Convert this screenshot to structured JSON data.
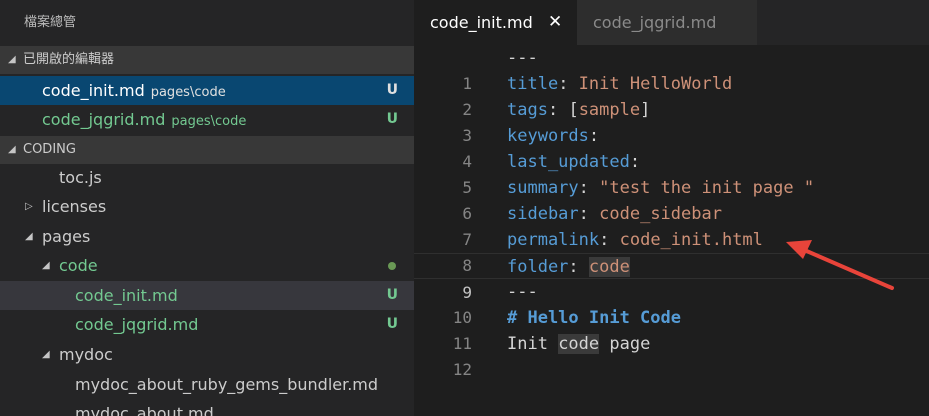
{
  "explorer": {
    "title": "檔案總管",
    "open_editors": {
      "label": "已開啟的編輯器",
      "items": [
        {
          "name": "code_init.md",
          "path": "pages\\code",
          "badge": "U"
        },
        {
          "name": "code_jqgrid.md",
          "path": "pages\\code",
          "badge": "U"
        }
      ]
    },
    "workspace": {
      "label": "CODING",
      "items": [
        {
          "name": "toc.js"
        },
        {
          "name": "licenses"
        },
        {
          "name": "pages"
        },
        {
          "name": "code"
        },
        {
          "name": "code_init.md",
          "badge": "U"
        },
        {
          "name": "code_jqgrid.md",
          "badge": "U"
        },
        {
          "name": "mydoc"
        },
        {
          "name": "mydoc_about_ruby_gems_bundler.md"
        },
        {
          "name": "mydoc_about.md"
        }
      ]
    }
  },
  "tabs": [
    {
      "label": "code_init.md",
      "close": "✕"
    },
    {
      "label": "code_jqgrid.md"
    }
  ],
  "editor": {
    "lines": [
      {
        "n": "1",
        "sep": "---"
      },
      {
        "n": "2",
        "key": "title",
        "colon": ": ",
        "val": "Init HelloWorld"
      },
      {
        "n": "3",
        "key": "tags",
        "colon": ": ",
        "bo": "[",
        "val": "sample",
        "bc": "]"
      },
      {
        "n": "4",
        "key": "keywords",
        "colon": ":"
      },
      {
        "n": "5",
        "key": "last_updated",
        "colon": ":"
      },
      {
        "n": "6",
        "key": "summary",
        "colon": ": ",
        "val": "\"test the init page \""
      },
      {
        "n": "7",
        "key": "sidebar",
        "colon": ": ",
        "val": "code_sidebar"
      },
      {
        "n": "8",
        "key": "permalink",
        "colon": ": ",
        "val": "code_init.html"
      },
      {
        "n": "9",
        "key": "folder",
        "colon": ": ",
        "val": "code"
      },
      {
        "n": "10",
        "sep": "---"
      },
      {
        "n": "11",
        "heading": "# Hello Init Code"
      },
      {
        "n": "12",
        "w1": "Init ",
        "w2": "code",
        "w3": " page"
      }
    ]
  },
  "colors": {
    "keyword": "#569cd6",
    "string": "#ce9178",
    "untracked": "#73c991",
    "selection": "#094771",
    "annotation_arrow": "#e8443a"
  }
}
